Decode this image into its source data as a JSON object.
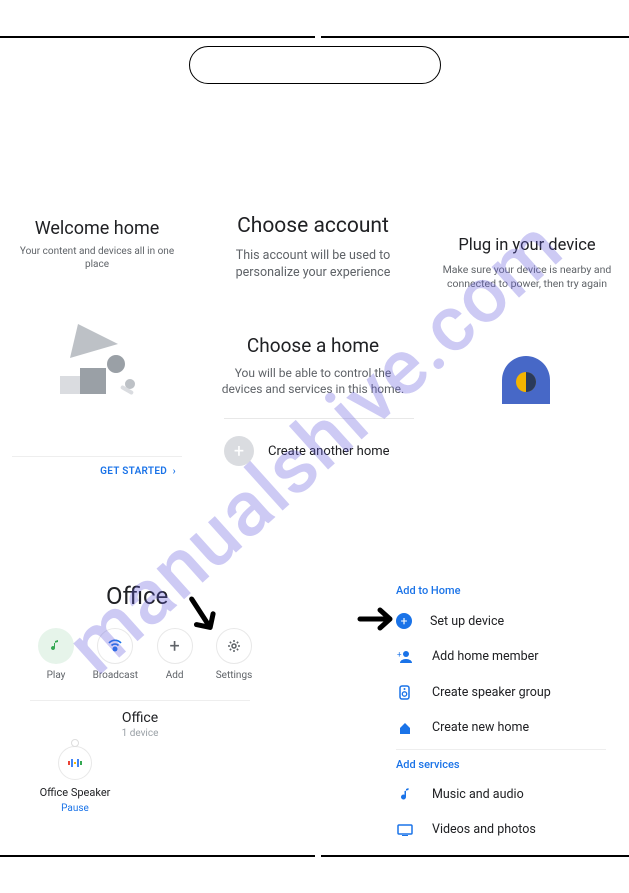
{
  "watermark": "manualshive.com",
  "welcome": {
    "title": "Welcome home",
    "subtitle": "Your content and devices all in one place",
    "cta": "GET STARTED"
  },
  "choose_account": {
    "title": "Choose account",
    "subtitle": "This account will be used to personalize your experience"
  },
  "choose_home": {
    "title": "Choose a home",
    "subtitle": "You will be able to control the devices and services in this home.",
    "create": "Create another home"
  },
  "plug": {
    "title": "Plug in your device",
    "subtitle": "Make sure your device is nearby and connected to power, then try again"
  },
  "office": {
    "title": "Office",
    "actions": {
      "play": "Play",
      "broadcast": "Broadcast",
      "add": "Add",
      "settings": "Settings"
    },
    "room": {
      "name": "Office",
      "devices": "1 device"
    },
    "device": {
      "name": "Office Speaker",
      "action": "Pause"
    }
  },
  "panel": {
    "section1": "Add to Home",
    "items1": {
      "setup": "Set up device",
      "member": "Add home member",
      "speaker": "Create speaker group",
      "newhome": "Create new home"
    },
    "section2": "Add services",
    "items2": {
      "music": "Music and audio",
      "videos": "Videos and photos"
    }
  }
}
